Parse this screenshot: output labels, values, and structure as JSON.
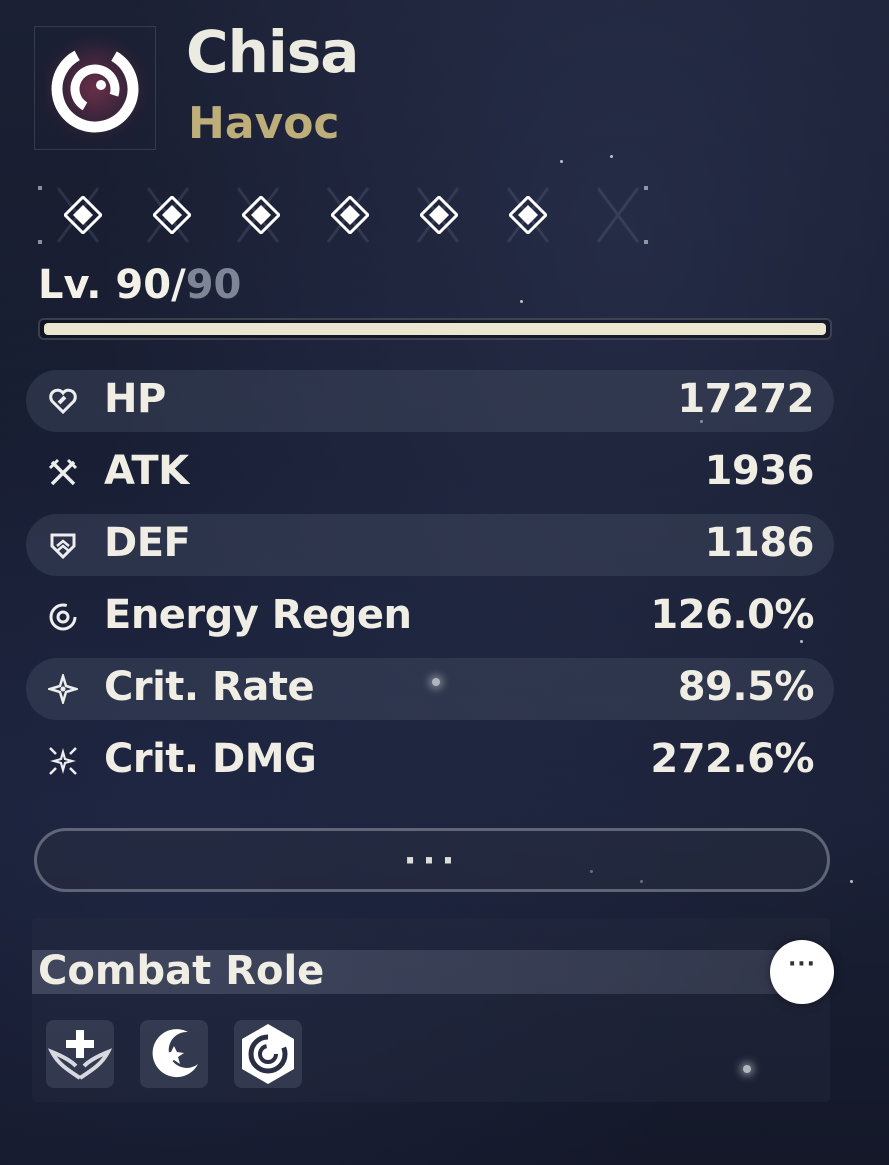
{
  "character": {
    "name": "Chisa",
    "element": "Havoc",
    "element_color": "#bdae7a"
  },
  "resonance_chain": {
    "unlocked": 6,
    "total": 6
  },
  "level": {
    "prefix": "Lv. ",
    "current": "90",
    "separator": "/",
    "max": "90",
    "progress": 1.0
  },
  "stats": [
    {
      "icon": "heart-icon",
      "label": "HP",
      "value": "17272"
    },
    {
      "icon": "crossed-swords-icon",
      "label": "ATK",
      "value": "1936"
    },
    {
      "icon": "shield-icon",
      "label": "DEF",
      "value": "1186"
    },
    {
      "icon": "energy-regen-icon",
      "label": "Energy Regen",
      "value": "126.0%"
    },
    {
      "icon": "crit-rate-icon",
      "label": "Crit. Rate",
      "value": "89.5%"
    },
    {
      "icon": "crit-dmg-icon",
      "label": "Crit. DMG",
      "value": "272.6%"
    }
  ],
  "more_stats_label": "···",
  "combat_role": {
    "title": "Combat Role",
    "more_label": "···",
    "roles": [
      "healer-wings-icon",
      "crescent-star-icon",
      "havoc-hexagon-icon"
    ]
  }
}
